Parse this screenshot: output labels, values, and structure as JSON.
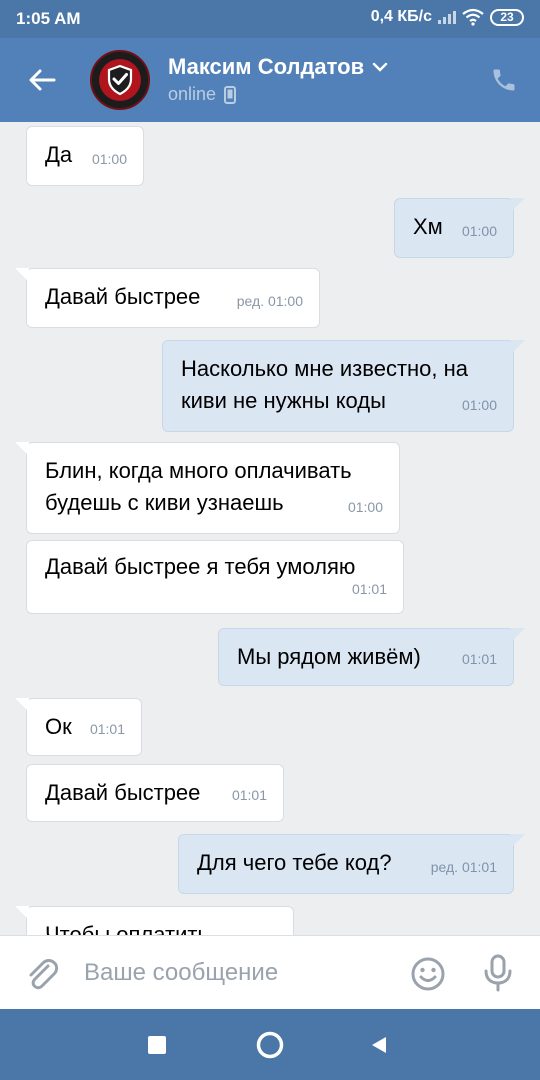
{
  "status_bar": {
    "time": "1:05 AM",
    "network_speed": "0,4 КБ/с",
    "battery": "23",
    "icons": [
      "signal-icon",
      "wifi-icon",
      "battery-icon"
    ]
  },
  "header": {
    "contact_name": "Максим Солдатов",
    "status": "online",
    "icons": [
      "back-arrow-icon",
      "chevron-down-icon",
      "mobile-icon",
      "phone-icon"
    ]
  },
  "messages": [
    {
      "direction": "in",
      "text": "Да",
      "time": "01:00"
    },
    {
      "direction": "out",
      "text": "Хм",
      "time": "01:00"
    },
    {
      "direction": "in",
      "text": "Давай быстрее",
      "time": "ред. 01:00"
    },
    {
      "direction": "out",
      "text": "Насколько мне известно, на киви не нужны коды",
      "time": "01:00"
    },
    {
      "direction": "in",
      "text": "Блин, когда много оплачивать будешь с киви узнаешь",
      "time": "01:00"
    },
    {
      "direction": "in",
      "text": "Давай быстрее я тебя умоляю",
      "time": "01:01"
    },
    {
      "direction": "out",
      "text": "Мы рядом живём)",
      "time": "01:01"
    },
    {
      "direction": "in",
      "text": "Ок",
      "time": "01:01"
    },
    {
      "direction": "in",
      "text": "Давай быстрее",
      "time": "01:01"
    },
    {
      "direction": "out",
      "text": "Для чего тебе код?",
      "time": "ред. 01:01"
    },
    {
      "direction": "in",
      "text": "Чтобы оплатить",
      "time": ""
    }
  ],
  "composer": {
    "placeholder": "Ваше сообщение",
    "value": "",
    "icons": [
      "paperclip-icon",
      "emoji-icon",
      "microphone-icon"
    ]
  },
  "navigation": {
    "icons": [
      "recent-apps-icon",
      "home-icon",
      "back-icon"
    ]
  },
  "colors": {
    "header": "#5181b8",
    "status_bar": "#4a76a8",
    "chat_background": "#edeef0",
    "incoming_bubble": "#ffffff",
    "outgoing_bubble": "#dbe6f3"
  }
}
